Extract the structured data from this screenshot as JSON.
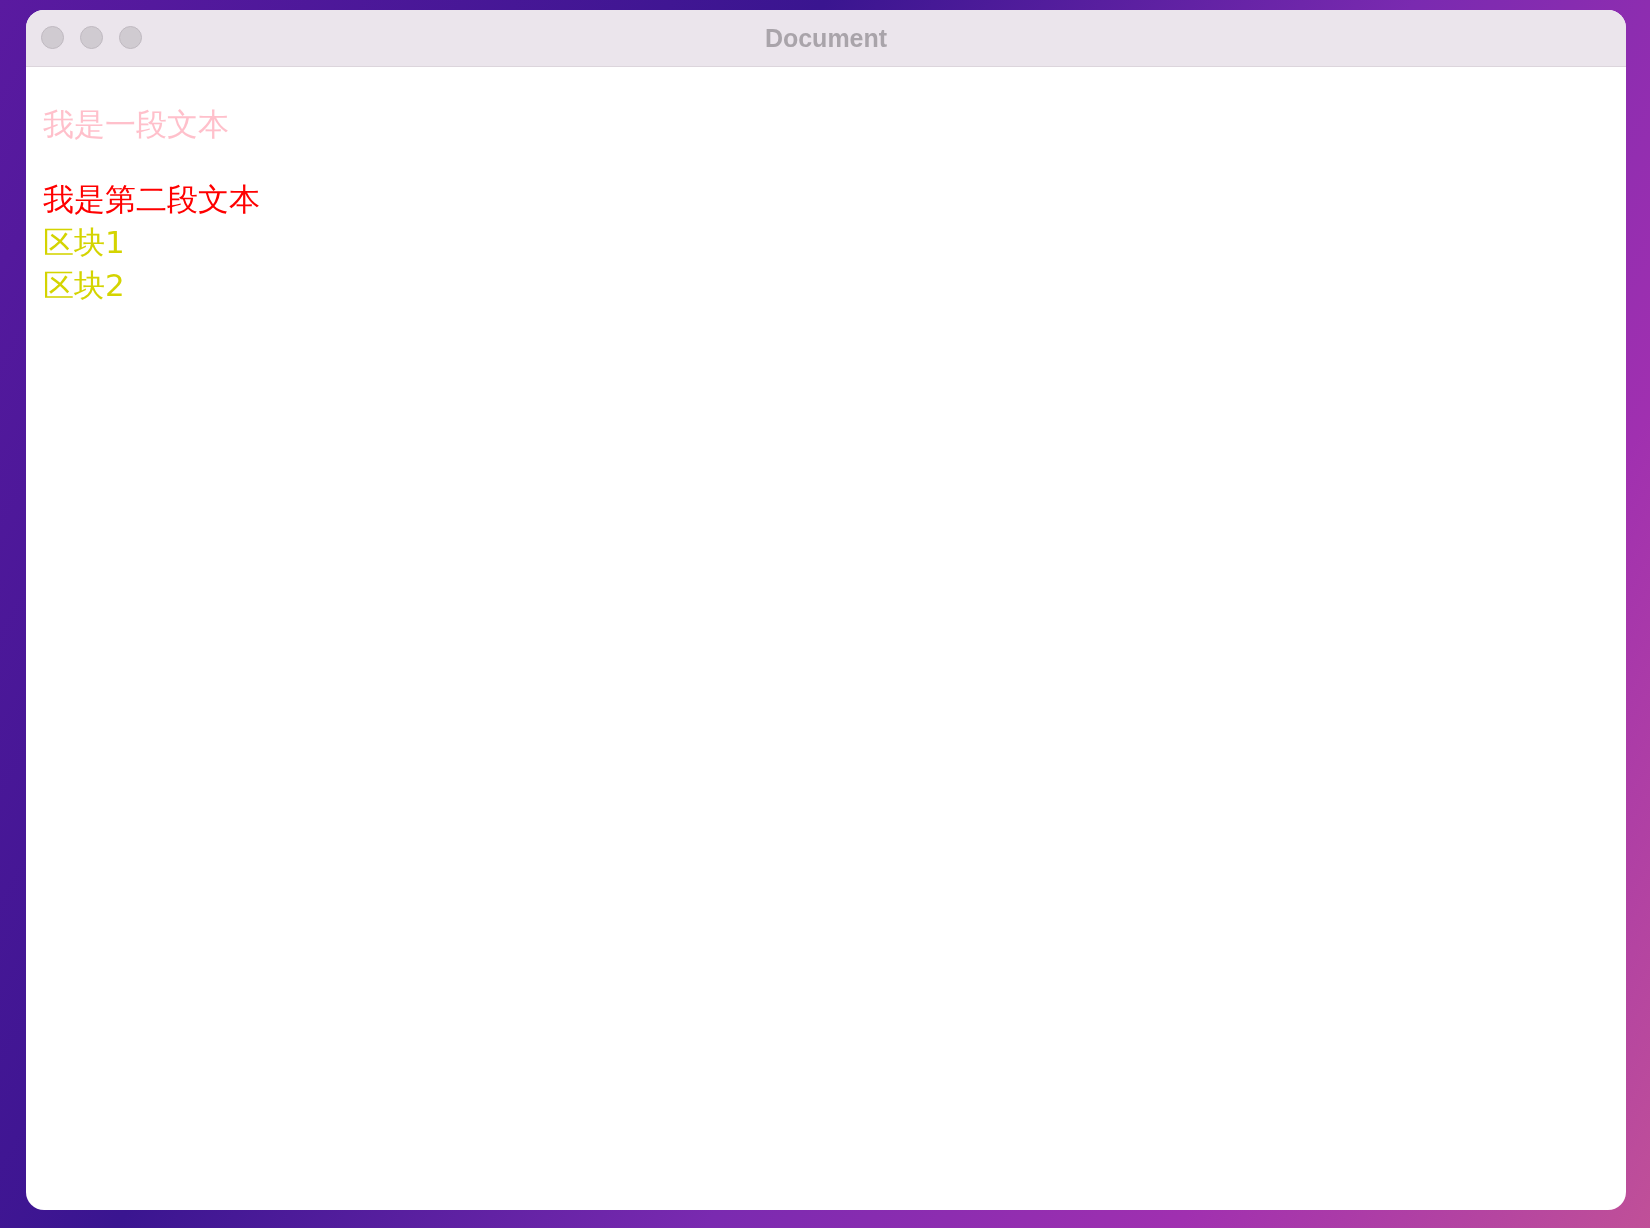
{
  "window": {
    "title": "Document"
  },
  "content": [
    {
      "kind": "paragraph",
      "text": "我是一段文本",
      "color": "#ffc0cb"
    },
    {
      "kind": "paragraph",
      "text": "我是第二段文本",
      "color": "#ff0000"
    },
    {
      "kind": "block",
      "text": "区块1",
      "color": "#d4d400"
    },
    {
      "kind": "block",
      "text": "区块2",
      "color": "#d4d400"
    }
  ]
}
